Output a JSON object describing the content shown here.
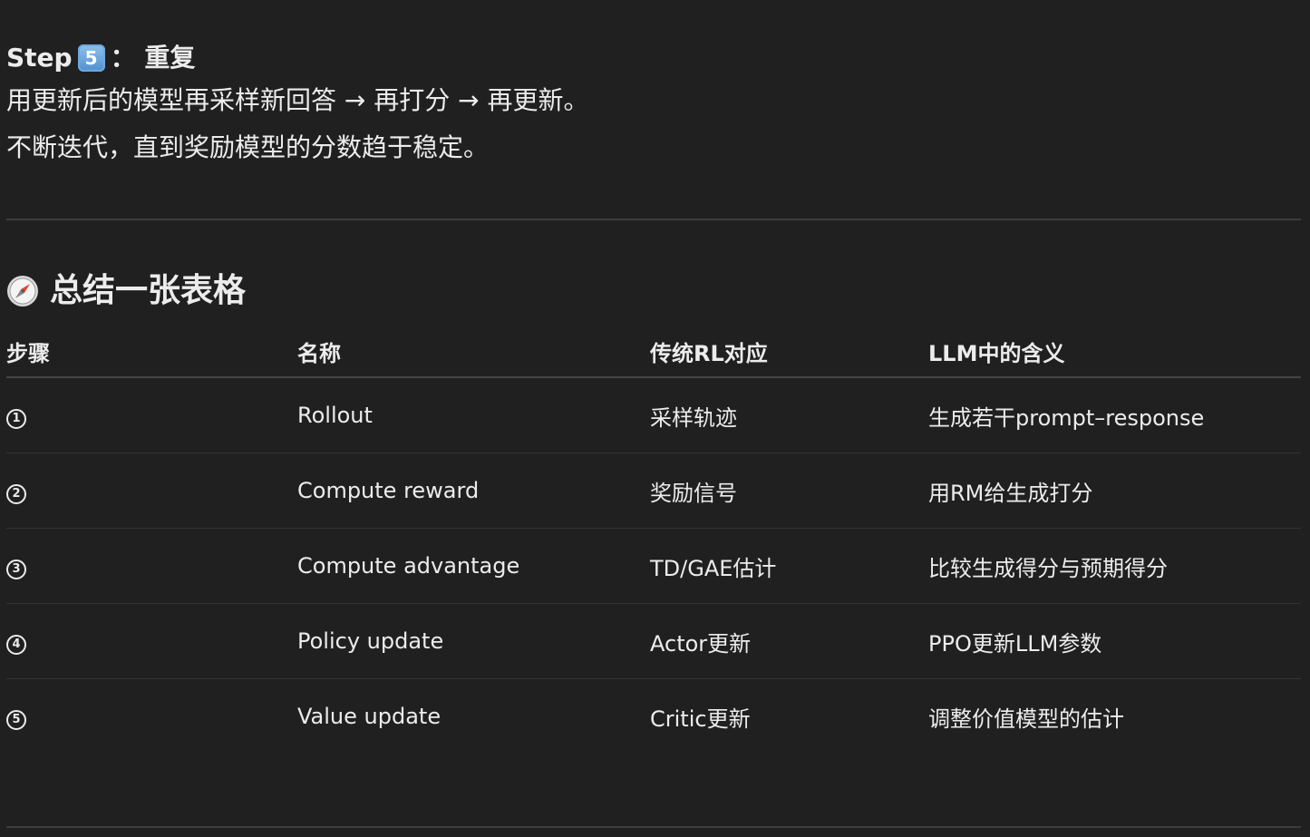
{
  "step_heading": {
    "prefix": "Step",
    "keycap": "5",
    "suffix": "： 重复"
  },
  "paragraphs": [
    "用更新后的模型再采样新回答 → 再打分 → 再更新。",
    "不断迭代，直到奖励模型的分数趋于稳定。"
  ],
  "section": {
    "icon": "compass-icon",
    "title": "总结一张表格"
  },
  "table": {
    "headers": [
      "步骤",
      "名称",
      "传统RL对应",
      "LLM中的含义"
    ],
    "rows": [
      {
        "step": "1",
        "name": "Rollout",
        "rl": "采样轨迹",
        "llm": "生成若干prompt–response"
      },
      {
        "step": "2",
        "name": "Compute reward",
        "rl": "奖励信号",
        "llm": "用RM给生成打分"
      },
      {
        "step": "3",
        "name": "Compute advantage",
        "rl": "TD/GAE估计",
        "llm": "比较生成得分与预期得分"
      },
      {
        "step": "4",
        "name": "Policy update",
        "rl": "Actor更新",
        "llm": "PPO更新LLM参数"
      },
      {
        "step": "5",
        "name": "Value update",
        "rl": "Critic更新",
        "llm": "调整价值模型的估计"
      }
    ]
  }
}
